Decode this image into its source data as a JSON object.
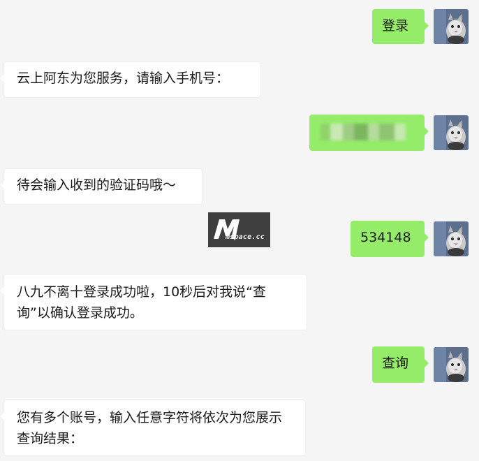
{
  "messages": [
    {
      "side": "out",
      "text": "登录"
    },
    {
      "side": "in",
      "text": "云上阿东为您服务，请输入手机号："
    },
    {
      "side": "out",
      "text": "",
      "redacted": true
    },
    {
      "side": "in",
      "text": "待会输入收到的验证码哦～"
    },
    {
      "side": "out",
      "text": "534148"
    },
    {
      "side": "in",
      "text": "八九不离十登录成功啦，10秒后对我说“查询”以确认登录成功。"
    },
    {
      "side": "out",
      "text": "查询"
    },
    {
      "side": "in",
      "text": "您有多个账号，输入任意字符将依次为您展示查询结果："
    }
  ],
  "watermark": {
    "logo": "M",
    "text": "mspace.cc"
  },
  "avatar_icon": "cat-avatar-icon",
  "colors": {
    "background": "#f5f5f5",
    "out_bubble": "#95ec69",
    "in_bubble": "#ffffff",
    "text": "#191919"
  }
}
